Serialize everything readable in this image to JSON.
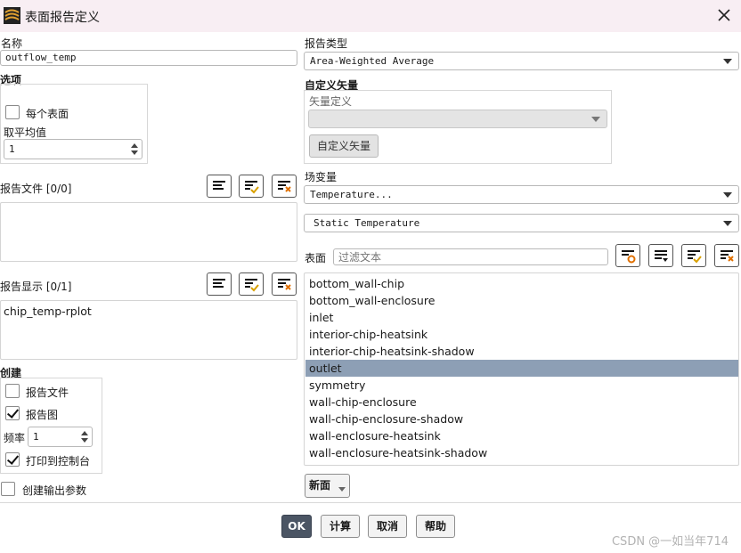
{
  "window": {
    "title": "表面报告定义"
  },
  "name": {
    "label": "名称",
    "value": "outflow_temp"
  },
  "options": {
    "label": "选项",
    "per_surface_label": "每个表面",
    "per_surface_checked": false,
    "average_over_label": "取平均值",
    "average_over_value": "1"
  },
  "report_files": {
    "label": "报告文件 [0/0]",
    "items": []
  },
  "report_plots": {
    "label": "报告显示 [0/1]",
    "items": [
      "chip_temp-rplot"
    ]
  },
  "create": {
    "label": "创建",
    "report_file_label": "报告文件",
    "report_file_checked": false,
    "report_plot_label": "报告图",
    "report_plot_checked": true,
    "frequency_label": "频率",
    "frequency_value": "1",
    "print_console_label": "打印到控制台",
    "print_console_checked": true
  },
  "create_output_param": {
    "label": "创建输出参数",
    "checked": false
  },
  "report_type": {
    "label": "报告类型",
    "value": "Area-Weighted Average"
  },
  "custom_vectors": {
    "label": "自定义矢量",
    "vector_def_label": "矢量定义",
    "vector_def_value": "",
    "button_label": "自定义矢量"
  },
  "field_variable": {
    "label": "场变量",
    "category": "Temperature...",
    "variable": "Static Temperature"
  },
  "surfaces": {
    "label": "表面",
    "filter_placeholder": "过滤文本",
    "selected": "outlet",
    "items": [
      "bottom_wall-chip",
      "bottom_wall-enclosure",
      "inlet",
      "interior-chip-heatsink",
      "interior-chip-heatsink-shadow",
      "outlet",
      "symmetry",
      "wall-chip-enclosure",
      "wall-chip-enclosure-shadow",
      "wall-enclosure-heatsink",
      "wall-enclosure-heatsink-shadow"
    ],
    "new_button": "新面"
  },
  "footer": {
    "ok": "OK",
    "compute": "计算",
    "cancel": "取消",
    "help": "帮助"
  },
  "watermark": "CSDN @一如当年714"
}
